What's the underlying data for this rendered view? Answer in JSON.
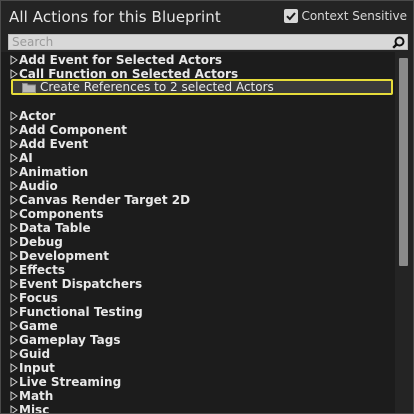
{
  "header": {
    "title": "All Actions for this Blueprint",
    "context_sensitive_label": "Context Sensitive",
    "context_sensitive_checked": true
  },
  "search": {
    "placeholder": "Search",
    "value": ""
  },
  "top_items": [
    {
      "label": "Add Event for Selected Actors"
    },
    {
      "label": "Call Function on Selected Actors"
    }
  ],
  "selected_item": {
    "label": "Create References to 2 selected Actors",
    "icon": "folder-icon"
  },
  "categories": [
    "Actor",
    "Add Component",
    "Add Event",
    "AI",
    "Animation",
    "Audio",
    "Canvas Render Target 2D",
    "Components",
    "Data Table",
    "Debug",
    "Development",
    "Effects",
    "Event Dispatchers",
    "Focus",
    "Functional Testing",
    "Game",
    "Gameplay Tags",
    "Guid",
    "Input",
    "Live Streaming",
    "Math",
    "Misc"
  ],
  "colors": {
    "highlight_border": "#e6dc3a",
    "panel_bg": "#242424",
    "list_bg": "#1c1c1c"
  }
}
